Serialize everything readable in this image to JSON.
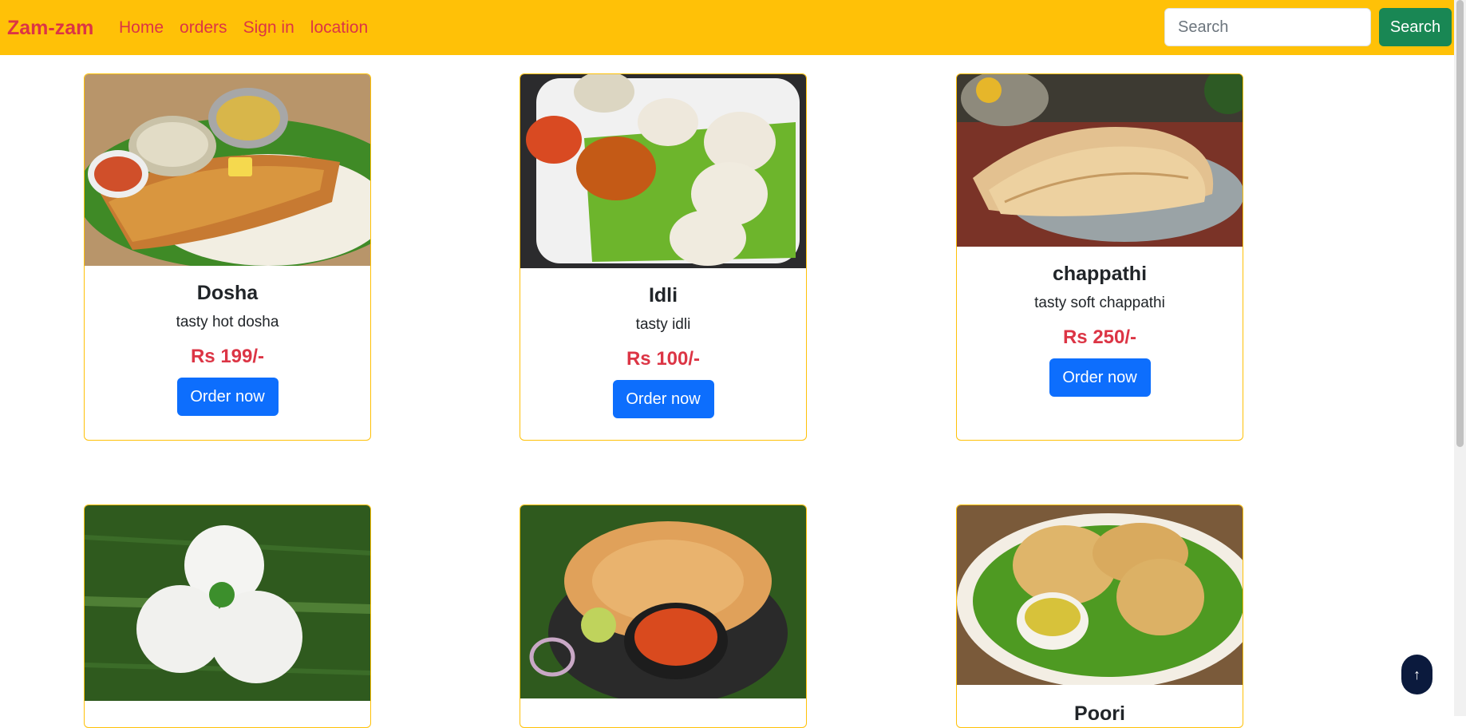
{
  "navbar": {
    "brand": "Zam-zam",
    "links": [
      "Home",
      "orders",
      "Sign in",
      "location"
    ],
    "search_placeholder": "Search",
    "search_button": "Search"
  },
  "cards": [
    {
      "title": "Dosha",
      "desc": "tasty hot dosha",
      "price": "Rs 199/-",
      "button": "Order now"
    },
    {
      "title": "Idli",
      "desc": "tasty idli",
      "price": "Rs 100/-",
      "button": "Order now"
    },
    {
      "title": "chappathi",
      "desc": "tasty soft chappathi",
      "price": "Rs 250/-",
      "button": "Order now"
    },
    {
      "title": "",
      "desc": "",
      "price": "",
      "button": ""
    },
    {
      "title": "",
      "desc": "",
      "price": "",
      "button": ""
    },
    {
      "title": "Poori",
      "desc": "",
      "price": "",
      "button": ""
    }
  ],
  "icons": {
    "back_to_top": "arrow-up-icon"
  },
  "colors": {
    "navbar": "#ffc107",
    "brand": "#dc3545",
    "price": "#dc3545",
    "order_button": "#0d6efd",
    "search_button": "#198754",
    "back_to_top": "#0b1a3d"
  }
}
